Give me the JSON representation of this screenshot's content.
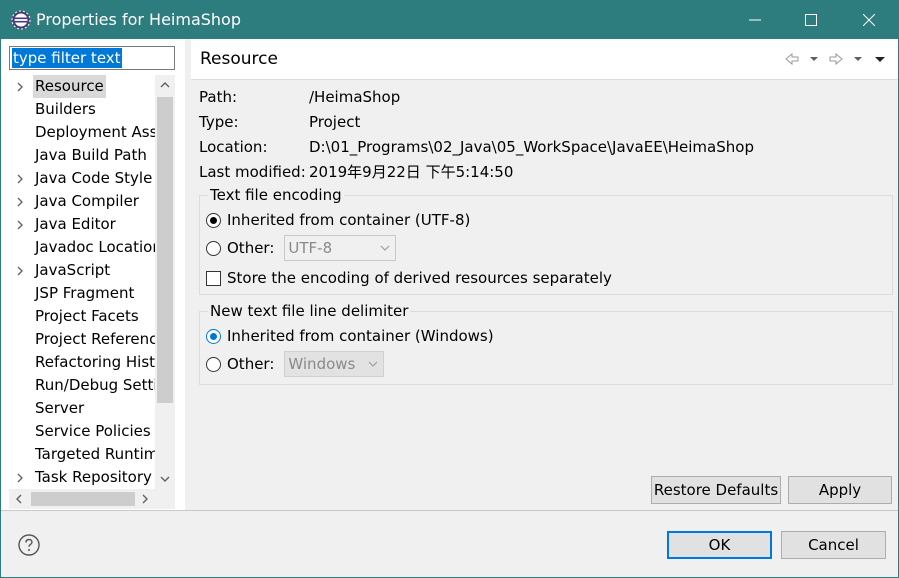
{
  "window": {
    "title": "Properties for HeimaShop",
    "colors": {
      "titlebar": "#2d7c7e",
      "accent": "#0078d7"
    },
    "controls": [
      "minimize-icon",
      "maximize-icon",
      "close-icon"
    ]
  },
  "filter": {
    "value": "type filter text"
  },
  "tree": {
    "items": [
      {
        "label": "Resource",
        "expandable": true,
        "selected": true
      },
      {
        "label": "Builders",
        "expandable": false
      },
      {
        "label": "Deployment Assembly",
        "expandable": false
      },
      {
        "label": "Java Build Path",
        "expandable": false
      },
      {
        "label": "Java Code Style",
        "expandable": true
      },
      {
        "label": "Java Compiler",
        "expandable": true
      },
      {
        "label": "Java Editor",
        "expandable": true
      },
      {
        "label": "Javadoc Location",
        "expandable": false
      },
      {
        "label": "JavaScript",
        "expandable": true
      },
      {
        "label": "JSP Fragment",
        "expandable": false
      },
      {
        "label": "Project Facets",
        "expandable": false
      },
      {
        "label": "Project References",
        "expandable": false
      },
      {
        "label": "Refactoring History",
        "expandable": false
      },
      {
        "label": "Run/Debug Settings",
        "expandable": false
      },
      {
        "label": "Server",
        "expandable": false
      },
      {
        "label": "Service Policies",
        "expandable": false
      },
      {
        "label": "Targeted Runtimes",
        "expandable": false
      },
      {
        "label": "Task Repository",
        "expandable": true
      }
    ]
  },
  "page": {
    "title": "Resource",
    "info": [
      {
        "key": "Path:",
        "value": "/HeimaShop"
      },
      {
        "key": "Type:",
        "value": "Project"
      },
      {
        "key": "Location:",
        "value": "D:\\01_Programs\\02_Java\\05_WorkSpace\\JavaEE\\HeimaShop"
      },
      {
        "key": "Last modified:",
        "value": "2019年9月22日 下午5:14:50"
      }
    ],
    "encoding": {
      "legend": "Text file encoding",
      "inherited_label": "Inherited from container (UTF-8)",
      "other_label": "Other:",
      "other_value": "UTF-8",
      "store_label": "Store the encoding of derived resources separately"
    },
    "delimiter": {
      "legend": "New text file line delimiter",
      "inherited_label": "Inherited from container (Windows)",
      "other_label": "Other:",
      "other_value": "Windows"
    },
    "restore_label": "Restore Defaults",
    "apply_label": "Apply"
  },
  "footer": {
    "ok_label": "OK",
    "cancel_label": "Cancel"
  }
}
